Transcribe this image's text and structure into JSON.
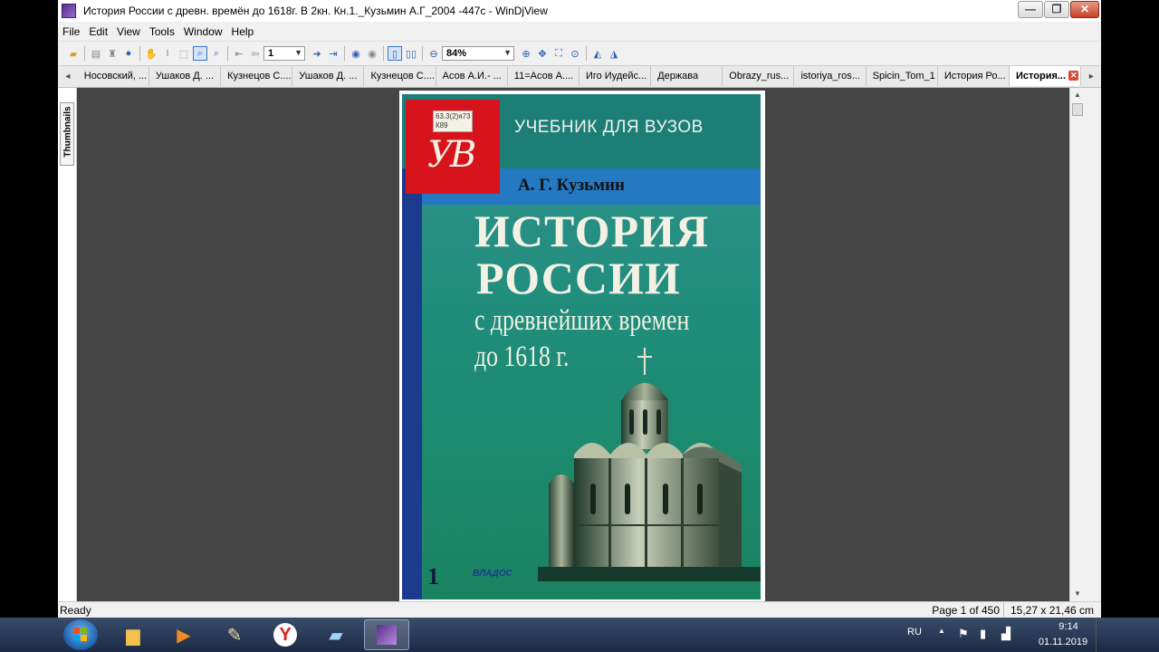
{
  "window": {
    "title": "История России с древн. времён до 1618г. В 2кн. Кн.1._Кузьмин А.Г_2004 -447с - WinDjView"
  },
  "menu": [
    "File",
    "Edit",
    "View",
    "Tools",
    "Window",
    "Help"
  ],
  "toolbar": {
    "page_value": "1",
    "zoom_value": "84%"
  },
  "tabs": [
    "Носовский, ...",
    "Ушаков Д. ...",
    "Кузнецов С....",
    "Ушаков Д. ...",
    "Кузнецов С....",
    "Асов А.И.- ...",
    "11=Асов А....",
    "Иго Иудейс...",
    "Держава",
    "Obrazy_rus...",
    "istoriya_ros...",
    "Spicin_Tom_1",
    "История Ро...",
    "История..."
  ],
  "sidebar": {
    "thumbnails_label": "Thumbnails"
  },
  "document": {
    "stamp_text": "63.3(2)я73 К89",
    "monogram": "УВ",
    "series": "УЧЕБНИК ДЛЯ ВУЗОВ",
    "author": "А. Г. Кузьмин",
    "title_line1": "ИСТОРИЯ",
    "title_line2": "РОССИИ",
    "subtitle_line1": "с древнейших времен",
    "subtitle_line2": "до 1618 г.",
    "volume": "1",
    "publisher": "ВЛАДОС"
  },
  "status": {
    "ready": "Ready",
    "page_info": "Page 1 of 450",
    "page_size": "15,27 x 21,46 cm"
  },
  "taskbar": {
    "language": "RU",
    "time": "9:14",
    "date": "01.11.2019"
  }
}
